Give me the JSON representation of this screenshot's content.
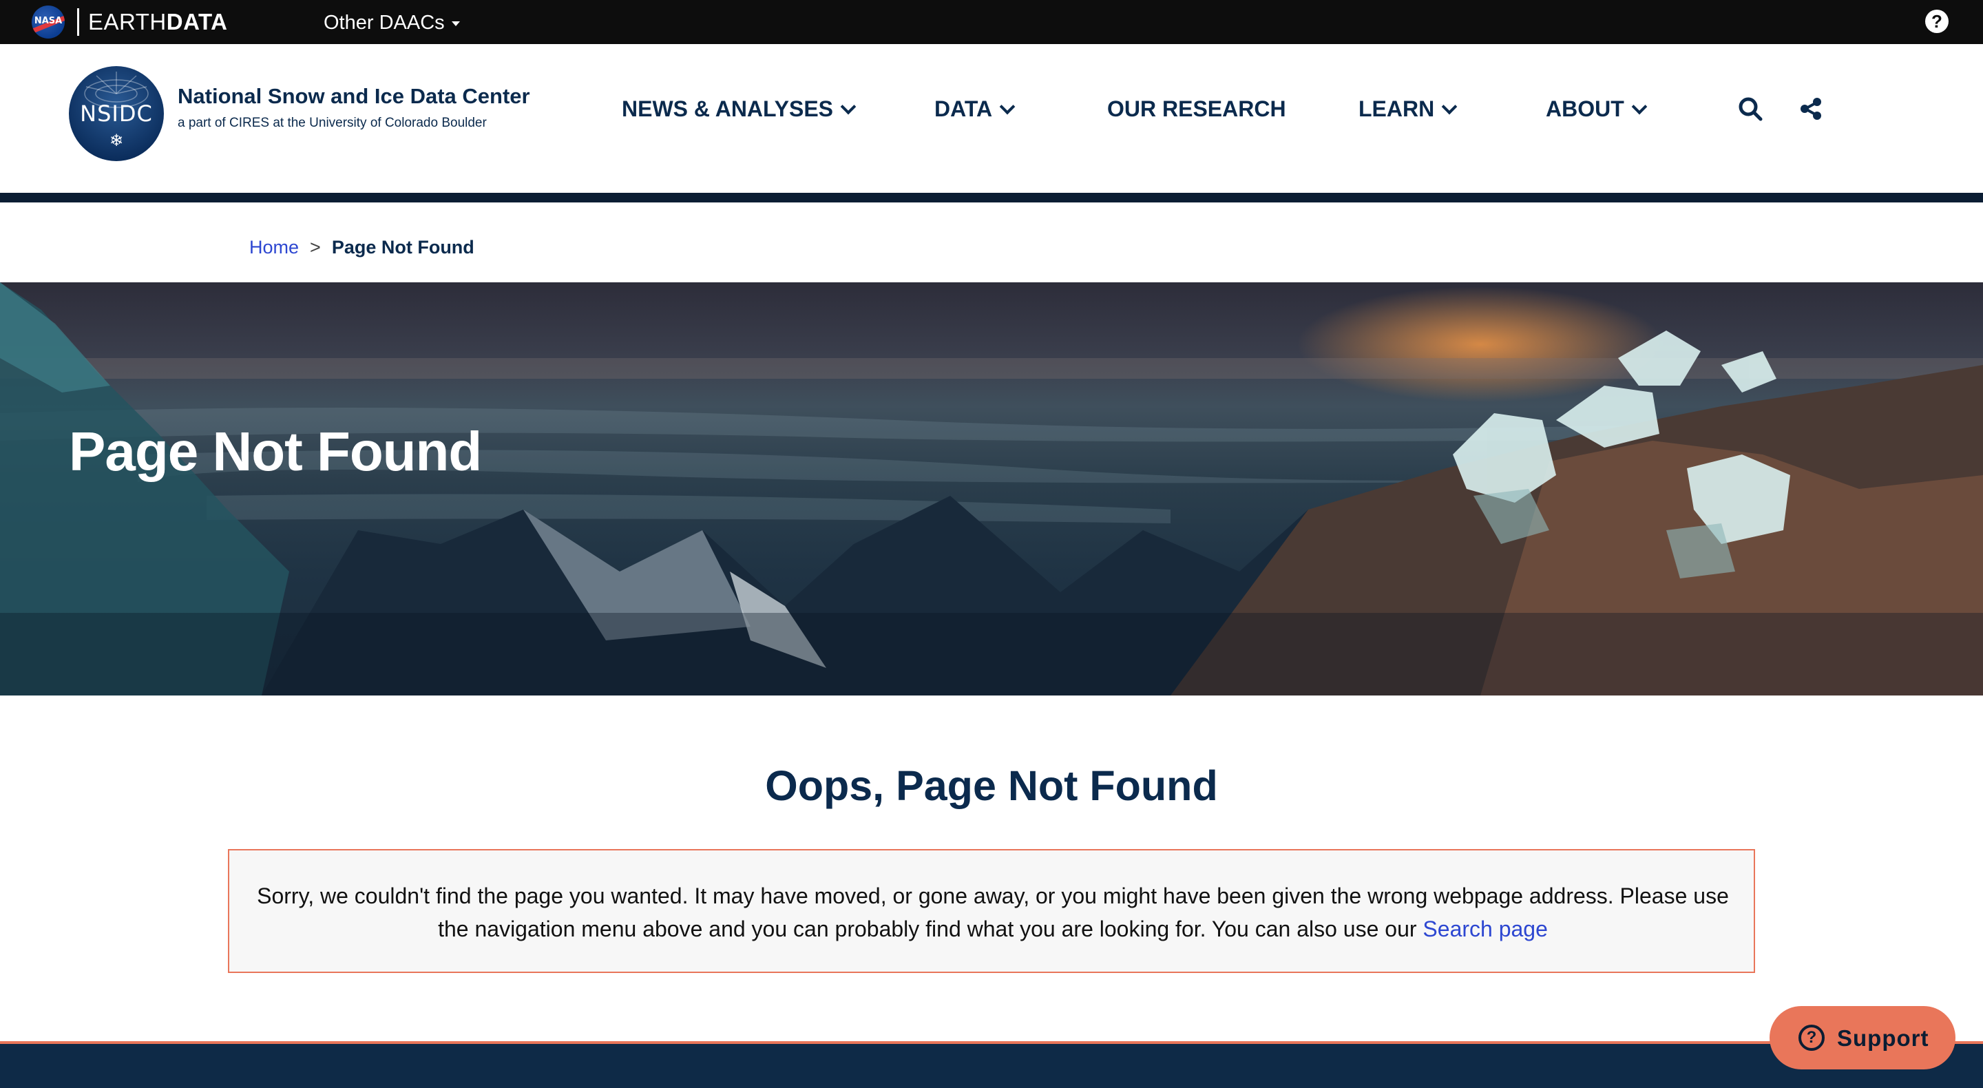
{
  "earthdata_bar": {
    "nasa_label": "NASA",
    "title_thin": "EARTH",
    "title_bold": "DATA",
    "other_daacs": "Other DAACs",
    "help": "?"
  },
  "header": {
    "logo_text": "NSIDC",
    "org_name": "National Snow and Ice Data Center",
    "org_sub": "a part of CIRES at the University of Colorado Boulder",
    "nav": {
      "news": "NEWS & ANALYSES",
      "data": "DATA",
      "research": "OUR RESEARCH",
      "learn": "LEARN",
      "about": "ABOUT"
    }
  },
  "breadcrumb": {
    "home": "Home",
    "separator": ">",
    "current": "Page Not Found"
  },
  "hero": {
    "title": "Page Not Found"
  },
  "main": {
    "heading": "Oops, Page Not Found",
    "message": "Sorry, we couldn't find the page you wanted. It may have moved, or gone away, or you might have been given the wrong webpage address. Please use the navigation menu above and you can probably find what you are looking for. You can also use our ",
    "search_link": "Search page"
  },
  "support": {
    "label": "Support",
    "icon": "?"
  },
  "colors": {
    "navy": "#0b2a4d",
    "link": "#2d47d1",
    "accent": "#e9765a",
    "footer": "#0e2a47"
  }
}
